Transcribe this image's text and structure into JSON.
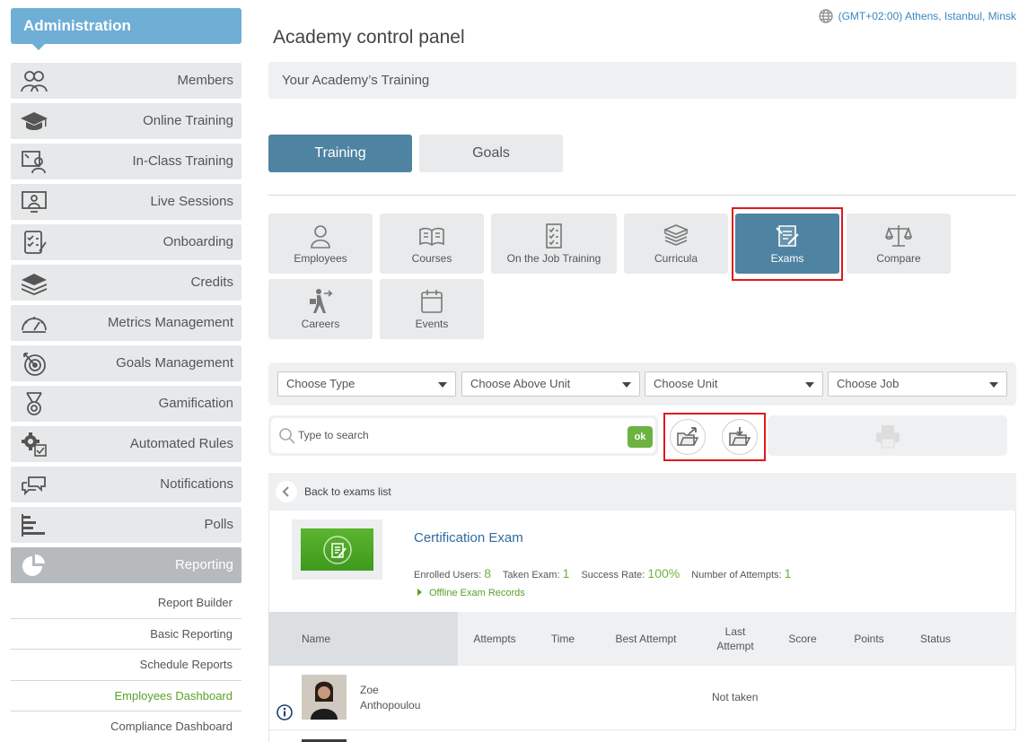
{
  "sidebar": {
    "header": "Administration",
    "items": [
      {
        "label": "Members",
        "icon": "members-icon"
      },
      {
        "label": "Online Training",
        "icon": "graduation-cap-icon"
      },
      {
        "label": "In-Class Training",
        "icon": "classroom-icon"
      },
      {
        "label": "Live Sessions",
        "icon": "live-session-icon"
      },
      {
        "label": "Onboarding",
        "icon": "onboarding-checklist-icon"
      },
      {
        "label": "Credits",
        "icon": "credits-stack-icon"
      },
      {
        "label": "Metrics Management",
        "icon": "gauge-icon"
      },
      {
        "label": "Goals Management",
        "icon": "target-icon"
      },
      {
        "label": "Gamification",
        "icon": "medal-icon"
      },
      {
        "label": "Automated Rules",
        "icon": "gear-rules-icon"
      },
      {
        "label": "Notifications",
        "icon": "chat-bubbles-icon"
      },
      {
        "label": "Polls",
        "icon": "bar-chart-icon"
      },
      {
        "label": "Reporting",
        "icon": "pie-chart-icon",
        "active": true
      }
    ],
    "sub_items": [
      {
        "label": "Report Builder"
      },
      {
        "label": "Basic Reporting"
      },
      {
        "label": "Schedule Reports"
      },
      {
        "label": "Employees Dashboard",
        "highlight": true
      },
      {
        "label": "Compliance Dashboard"
      }
    ]
  },
  "header": {
    "timezone": "(GMT+02:00) Athens, Istanbul, Minsk",
    "page_title": "Academy control panel",
    "section_title": "Your Academy’s Training"
  },
  "tabs": {
    "training": "Training",
    "goals": "Goals"
  },
  "tiles": [
    {
      "label": "Employees",
      "icon": "person-icon"
    },
    {
      "label": "Courses",
      "icon": "book-icon"
    },
    {
      "label": "On the Job Training",
      "icon": "checklist-icon"
    },
    {
      "label": "Curricula",
      "icon": "books-stack-icon"
    },
    {
      "label": "Exams",
      "icon": "exam-icon",
      "selected": true
    },
    {
      "label": "Compare",
      "icon": "scales-icon"
    },
    {
      "label": "Careers",
      "icon": "career-walker-icon"
    },
    {
      "label": "Events",
      "icon": "calendar-icon"
    }
  ],
  "filters": {
    "type": "Choose Type",
    "above_unit": "Choose Above Unit",
    "unit": "Choose Unit",
    "job": "Choose Job"
  },
  "search": {
    "placeholder": "Type to search",
    "ok": "ok"
  },
  "back_link": "Back to exams list",
  "exam": {
    "title": "Certification Exam",
    "enrolled_label": "Enrolled Users:",
    "enrolled_value": "8",
    "taken_label": "Taken Exam:",
    "taken_value": "1",
    "success_label": "Success Rate:",
    "success_value": "100%",
    "attempts_label": "Number of Attempts:",
    "attempts_value": "1",
    "offline_link": "Offline Exam Records"
  },
  "table": {
    "columns": {
      "name": "Name",
      "attempts": "Attempts",
      "time": "Time",
      "best_attempt": "Best Attempt",
      "last_attempt": "Last Attempt",
      "score": "Score",
      "points": "Points",
      "status": "Status"
    },
    "rows": [
      {
        "first_name": "Zoe",
        "last_name": "Anthopoulou",
        "last_attempt": "Not taken"
      }
    ]
  },
  "colors": {
    "primary": "#4f83a2",
    "admin_header": "#6faed5",
    "accent_green": "#6cb33f",
    "highlight_red": "#e0191b",
    "link_blue": "#2f6c9e"
  }
}
